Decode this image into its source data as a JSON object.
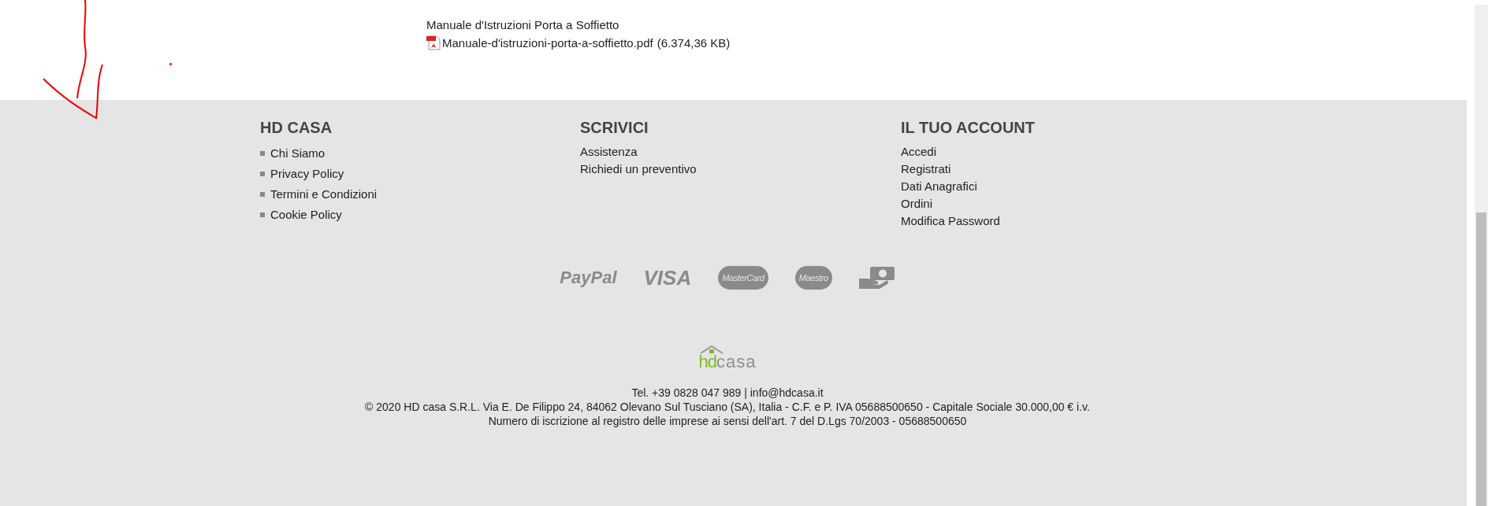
{
  "attachment": {
    "title": "Manuale d'Istruzioni Porta a Soffietto",
    "file": "Manuale-d'istruzioni-porta-a-soffietto.pdf",
    "size": "(6.374,36 KB)"
  },
  "footer": {
    "columns": [
      {
        "heading": "HD CASA",
        "bulleted": true,
        "links": [
          "Chi Siamo",
          "Privacy Policy",
          "Termini e Condizioni",
          "Cookie Policy"
        ]
      },
      {
        "heading": "SCRIVICI",
        "bulleted": false,
        "links": [
          "Assistenza",
          "Richiedi un preventivo"
        ]
      },
      {
        "heading": "IL TUO ACCOUNT",
        "bulleted": false,
        "links": [
          "Accedi",
          "Registrati",
          "Dati Anagrafici",
          "Ordini",
          "Modifica Password"
        ]
      }
    ],
    "payment_methods": [
      {
        "kind": "wordmark",
        "label": "PayPal"
      },
      {
        "kind": "wordmark",
        "label": "VISA"
      },
      {
        "kind": "circles",
        "label": "MasterCard"
      },
      {
        "kind": "circles",
        "label": "Maestro"
      },
      {
        "kind": "cash"
      }
    ],
    "logo": {
      "prefix": "hd",
      "suffix": "casa"
    },
    "legal": [
      "Tel. +39 0828 047 989 | info@hdcasa.it",
      "© 2020 HD casa S.R.L. Via E. De Filippo 24, 84062 Olevano Sul Tusciano (SA), Italia - C.F. e P. IVA 05688500650 - Capitale Sociale 30.000,00 € i.v.",
      "Numero di iscrizione al registro delle imprese ai sensi dell'art. 7 del D.Lgs 70/2003 - 05688500650"
    ]
  }
}
